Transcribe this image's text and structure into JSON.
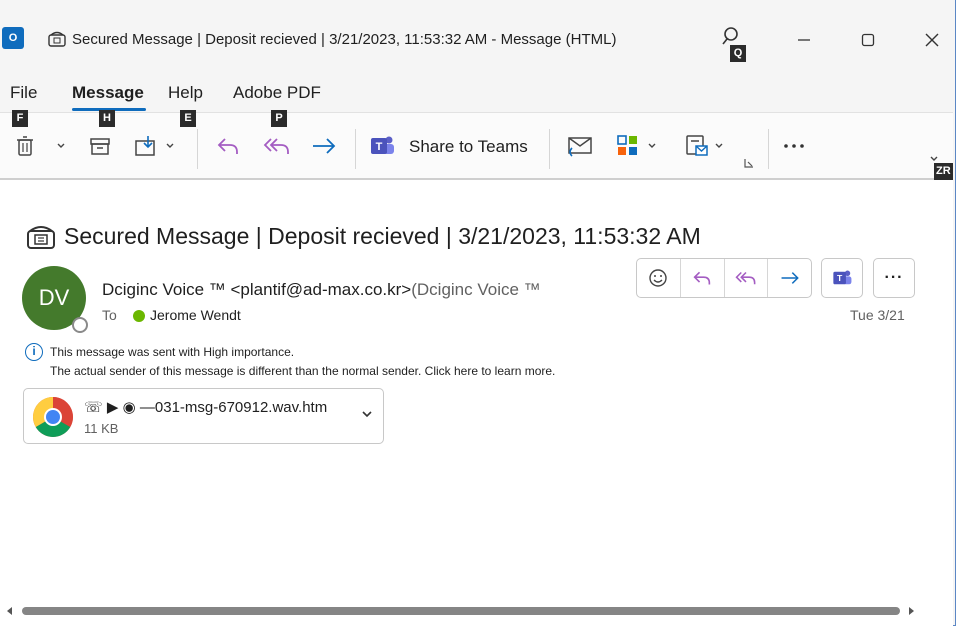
{
  "window": {
    "app_icon_text": "O",
    "title": "Secured Message | Deposit recieved | 3/21/2023, 11:53:32 AM   -  Message (HTML)",
    "search_keytip": "Q",
    "ribbon_keytip": "ZR"
  },
  "menu": {
    "items": [
      {
        "label": "File",
        "keytip": "F"
      },
      {
        "label": "Message",
        "keytip": "H"
      },
      {
        "label": "Help",
        "keytip": "E"
      },
      {
        "label": "Adobe PDF",
        "keytip": "P"
      }
    ]
  },
  "ribbon": {
    "share_to_teams": "Share to Teams"
  },
  "message": {
    "subject": "Secured Message | Deposit recieved | 3/21/2023, 11:53:32 AM",
    "avatar_initials": "DV",
    "sender": "Dciginc Voice ™ <plantif@ad-max.co.kr>",
    "sender_tail": "(Dciginc Voice ™",
    "to_label": "To",
    "to_name": "Jerome Wendt",
    "date": "Tue 3/21",
    "info_line1": "This message was sent with High importance.",
    "info_line2": "The actual sender of this message is different than the normal sender. Click here to learn more.",
    "more_label": "···"
  },
  "attachment": {
    "name": "☏ ▶ ◉ —031-msg-670912.wav.htm",
    "size": "11 KB"
  },
  "colors": {
    "accent": "#0f6cbd",
    "avatar": "#447a2c",
    "reply_purple": "#a45dc2",
    "forward_blue": "#0f6cbd"
  }
}
